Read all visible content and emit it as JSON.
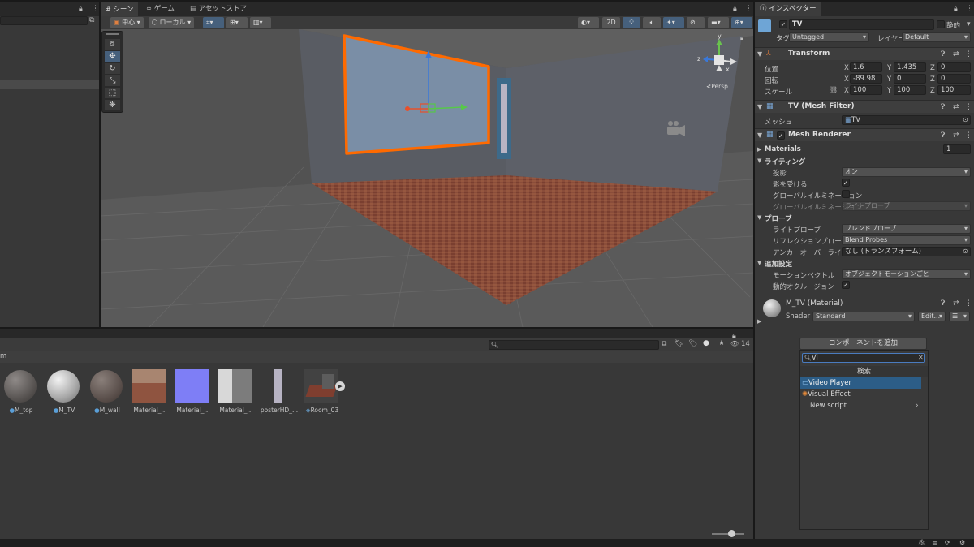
{
  "left_panel": {
    "lock_icon": "lock-icon",
    "menu_icon": "kebab-icon"
  },
  "scene_tabs": {
    "scene": "シーン",
    "game": "ゲーム",
    "asset_store": "アセットストア"
  },
  "scene_toolbar": {
    "pivot": "中心",
    "space": "ローカル",
    "mode_2d": "2D"
  },
  "gizmo": {
    "x": "x",
    "y": "y",
    "z": "z",
    "persp": "≮Persp"
  },
  "inspector": {
    "tab": "インスペクター",
    "object_name": "TV",
    "static_label": "静的",
    "tag_label": "タグ",
    "tag_value": "Untagged",
    "layer_label": "レイヤー",
    "layer_value": "Default",
    "transform": {
      "title": "Transform",
      "rows": [
        {
          "label": "位置",
          "x": "1.6",
          "y": "1.435",
          "z": "0"
        },
        {
          "label": "回転",
          "x": "-89.98",
          "y": "0",
          "z": "0"
        },
        {
          "label": "スケール",
          "x": "100",
          "y": "100",
          "z": "100"
        }
      ],
      "axis_x": "X",
      "axis_y": "Y",
      "axis_z": "Z"
    },
    "mesh_filter": {
      "title": "TV (Mesh Filter)",
      "mesh_label": "メッシュ",
      "mesh_value": "TV"
    },
    "mesh_renderer": {
      "title": "Mesh Renderer",
      "materials_label": "Materials",
      "materials_count": "1",
      "lighting_label": "ライティング",
      "cast_shadows_label": "投影",
      "cast_shadows_value": "オン",
      "receive_shadows_label": "影を受ける",
      "gi_label": "グローバルイルミネーション",
      "gi_label2": "グローバルイルミネーション",
      "gi_value2": "ライトプローブ",
      "probes_label": "プローブ",
      "light_probes_label": "ライトプローブ",
      "light_probes_value": "ブレンドプローブ",
      "reflection_label": "リフレクションプローブ",
      "reflection_value": "Blend Probes",
      "anchor_label": "アンカーオーバーライド",
      "anchor_value": "なし (トランスフォーム)",
      "additional_label": "追加設定",
      "motion_label": "モーションベクトル",
      "motion_value": "オブジェクトモーションごと",
      "occlusion_label": "動的オクルージョン"
    },
    "material": {
      "title": "M_TV (Material)",
      "shader_label": "Shader",
      "shader_value": "Standard",
      "edit_label": "Edit..."
    },
    "add_component": {
      "button": "コンポーネントを追加",
      "search_value": "Vi",
      "section": "検索",
      "items": [
        "Video Player",
        "Visual Effect",
        "New script"
      ]
    }
  },
  "project": {
    "path": "m",
    "count": "14",
    "assets": [
      {
        "name": "M_top"
      },
      {
        "name": "M_TV"
      },
      {
        "name": "M_wall"
      },
      {
        "name": "Material_..."
      },
      {
        "name": "Material_..."
      },
      {
        "name": "Material_..."
      },
      {
        "name": "posterHD_..."
      },
      {
        "name": "Room_03"
      }
    ]
  },
  "colors": {
    "selection": "#ff6a00",
    "accent_blue": "#2c5d87",
    "panel": "#383838"
  }
}
